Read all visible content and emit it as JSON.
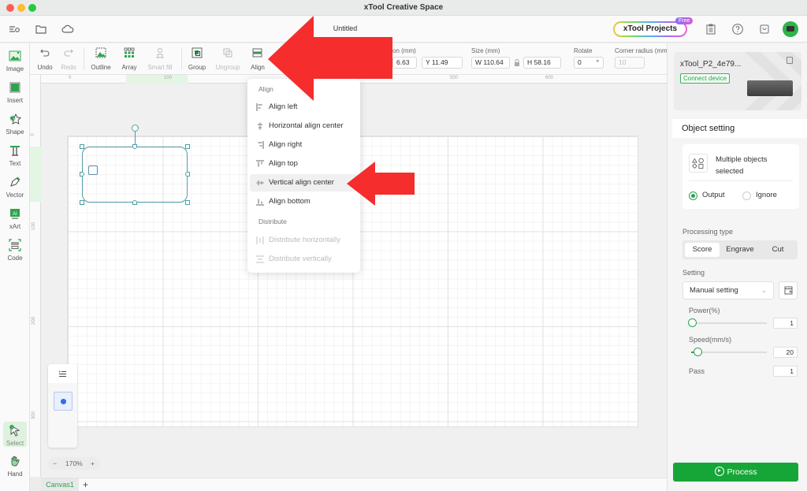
{
  "window": {
    "title": "xTool Creative Space"
  },
  "header": {
    "doc_title": "Untitled",
    "projects_label": "xTool Projects",
    "free_badge": "Free",
    "icons": [
      "menu-settings-icon",
      "folder-icon",
      "cloud-icon",
      "clipboard-icon",
      "help-icon",
      "shop-icon",
      "avatar"
    ]
  },
  "rail": {
    "items": [
      {
        "label": "Image",
        "icon": "image-icon"
      },
      {
        "label": "Insert",
        "icon": "insert-icon"
      },
      {
        "label": "Shape",
        "icon": "shape-icon"
      },
      {
        "label": "Text",
        "icon": "text-icon"
      },
      {
        "label": "Vector",
        "icon": "pen-icon"
      },
      {
        "label": "xArt",
        "icon": "ai-icon"
      },
      {
        "label": "Code",
        "icon": "barcode-icon"
      }
    ],
    "bottom": [
      {
        "label": "Select",
        "icon": "cursor-icon",
        "active": true
      },
      {
        "label": "Hand",
        "icon": "hand-icon"
      }
    ]
  },
  "toolbar": {
    "undo": "Undo",
    "redo": "Redo",
    "outline": "Outline",
    "array": "Array",
    "smart_fill": "Smart fill",
    "group": "Group",
    "ungroup": "Ungroup",
    "align": "Align",
    "position_label": "Position (mm)",
    "position_label_visible": "on (mm)",
    "x_value": "6.63",
    "y_value": "Y 11.49",
    "size_label": "Size (mm)",
    "w_value": "W 110.64",
    "h_value": "H 58.16",
    "rotate_label": "Rotate",
    "rotate_value": "0",
    "rotate_unit": "°",
    "corner_label": "Corner radius (mm)",
    "corner_value": "10"
  },
  "rulers": {
    "h_ticks": [
      "0",
      "100",
      "400",
      "500",
      "600"
    ],
    "v_ticks": [
      "0",
      "100",
      "200",
      "300"
    ]
  },
  "align_menu": {
    "align_heading": "Align",
    "items": [
      {
        "label": "Align left",
        "icon": "align-left-icon",
        "state": "normal"
      },
      {
        "label": "Horizontal align center",
        "icon": "align-hcenter-icon",
        "state": "normal"
      },
      {
        "label": "Align right",
        "icon": "align-right-icon",
        "state": "normal"
      },
      {
        "label": "Align top",
        "icon": "align-top-icon",
        "state": "normal"
      },
      {
        "label": "Vertical align center",
        "icon": "align-vcenter-icon",
        "state": "hover"
      },
      {
        "label": "Align bottom",
        "icon": "align-bottom-icon",
        "state": "normal"
      }
    ],
    "distribute_heading": "Distribute",
    "distribute_items": [
      {
        "label": "Distribute horizontally",
        "icon": "distribute-h-icon",
        "state": "disabled"
      },
      {
        "label": "Distribute vertically",
        "icon": "distribute-v-icon",
        "state": "disabled"
      }
    ]
  },
  "canvas": {
    "zoom": "170%",
    "zoom_out": "−",
    "zoom_in": "+",
    "tabs": [
      "Canvas1"
    ],
    "add_tab": "+"
  },
  "device": {
    "name": "xTool_P2_4e79...",
    "connect_label": "Connect device"
  },
  "object_setting": {
    "title": "Object setting",
    "selection_text": "Multiple objects selected",
    "output_label": "Output",
    "ignore_label": "Ignore",
    "output_selected": true,
    "processing_type_label": "Processing type",
    "processing_types": [
      "Score",
      "Engrave",
      "Cut"
    ],
    "processing_selected": "Score",
    "setting_label": "Setting",
    "setting_value": "Manual setting",
    "power_label": "Power(%)",
    "power_value": "1",
    "power_fraction": 0.01,
    "speed_label": "Speed(mm/s)",
    "speed_value": "20",
    "speed_fraction": 0.08,
    "pass_label": "Pass",
    "pass_value": "1"
  },
  "process_button": "Process",
  "colors": {
    "accent_green": "#16a637",
    "selection": "#4f9ea2",
    "annotation_red": "#f52d2d"
  }
}
